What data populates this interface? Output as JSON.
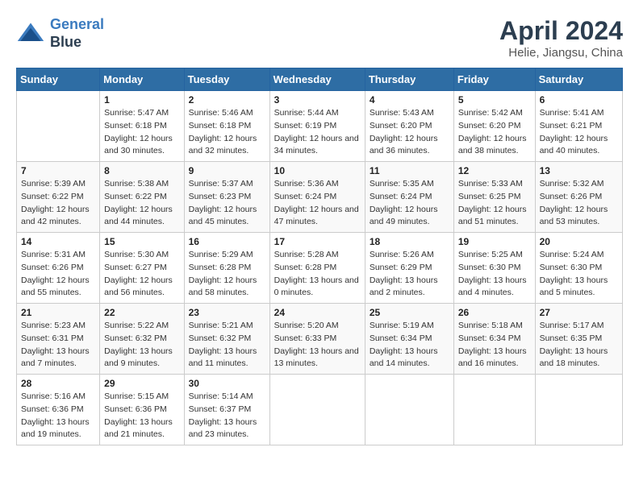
{
  "header": {
    "logo_line1": "General",
    "logo_line2": "Blue",
    "month_year": "April 2024",
    "location": "Helie, Jiangsu, China"
  },
  "days_of_week": [
    "Sunday",
    "Monday",
    "Tuesday",
    "Wednesday",
    "Thursday",
    "Friday",
    "Saturday"
  ],
  "weeks": [
    [
      {
        "day": "",
        "sunrise": "",
        "sunset": "",
        "daylight": ""
      },
      {
        "day": "1",
        "sunrise": "Sunrise: 5:47 AM",
        "sunset": "Sunset: 6:18 PM",
        "daylight": "Daylight: 12 hours and 30 minutes."
      },
      {
        "day": "2",
        "sunrise": "Sunrise: 5:46 AM",
        "sunset": "Sunset: 6:18 PM",
        "daylight": "Daylight: 12 hours and 32 minutes."
      },
      {
        "day": "3",
        "sunrise": "Sunrise: 5:44 AM",
        "sunset": "Sunset: 6:19 PM",
        "daylight": "Daylight: 12 hours and 34 minutes."
      },
      {
        "day": "4",
        "sunrise": "Sunrise: 5:43 AM",
        "sunset": "Sunset: 6:20 PM",
        "daylight": "Daylight: 12 hours and 36 minutes."
      },
      {
        "day": "5",
        "sunrise": "Sunrise: 5:42 AM",
        "sunset": "Sunset: 6:20 PM",
        "daylight": "Daylight: 12 hours and 38 minutes."
      },
      {
        "day": "6",
        "sunrise": "Sunrise: 5:41 AM",
        "sunset": "Sunset: 6:21 PM",
        "daylight": "Daylight: 12 hours and 40 minutes."
      }
    ],
    [
      {
        "day": "7",
        "sunrise": "Sunrise: 5:39 AM",
        "sunset": "Sunset: 6:22 PM",
        "daylight": "Daylight: 12 hours and 42 minutes."
      },
      {
        "day": "8",
        "sunrise": "Sunrise: 5:38 AM",
        "sunset": "Sunset: 6:22 PM",
        "daylight": "Daylight: 12 hours and 44 minutes."
      },
      {
        "day": "9",
        "sunrise": "Sunrise: 5:37 AM",
        "sunset": "Sunset: 6:23 PM",
        "daylight": "Daylight: 12 hours and 45 minutes."
      },
      {
        "day": "10",
        "sunrise": "Sunrise: 5:36 AM",
        "sunset": "Sunset: 6:24 PM",
        "daylight": "Daylight: 12 hours and 47 minutes."
      },
      {
        "day": "11",
        "sunrise": "Sunrise: 5:35 AM",
        "sunset": "Sunset: 6:24 PM",
        "daylight": "Daylight: 12 hours and 49 minutes."
      },
      {
        "day": "12",
        "sunrise": "Sunrise: 5:33 AM",
        "sunset": "Sunset: 6:25 PM",
        "daylight": "Daylight: 12 hours and 51 minutes."
      },
      {
        "day": "13",
        "sunrise": "Sunrise: 5:32 AM",
        "sunset": "Sunset: 6:26 PM",
        "daylight": "Daylight: 12 hours and 53 minutes."
      }
    ],
    [
      {
        "day": "14",
        "sunrise": "Sunrise: 5:31 AM",
        "sunset": "Sunset: 6:26 PM",
        "daylight": "Daylight: 12 hours and 55 minutes."
      },
      {
        "day": "15",
        "sunrise": "Sunrise: 5:30 AM",
        "sunset": "Sunset: 6:27 PM",
        "daylight": "Daylight: 12 hours and 56 minutes."
      },
      {
        "day": "16",
        "sunrise": "Sunrise: 5:29 AM",
        "sunset": "Sunset: 6:28 PM",
        "daylight": "Daylight: 12 hours and 58 minutes."
      },
      {
        "day": "17",
        "sunrise": "Sunrise: 5:28 AM",
        "sunset": "Sunset: 6:28 PM",
        "daylight": "Daylight: 13 hours and 0 minutes."
      },
      {
        "day": "18",
        "sunrise": "Sunrise: 5:26 AM",
        "sunset": "Sunset: 6:29 PM",
        "daylight": "Daylight: 13 hours and 2 minutes."
      },
      {
        "day": "19",
        "sunrise": "Sunrise: 5:25 AM",
        "sunset": "Sunset: 6:30 PM",
        "daylight": "Daylight: 13 hours and 4 minutes."
      },
      {
        "day": "20",
        "sunrise": "Sunrise: 5:24 AM",
        "sunset": "Sunset: 6:30 PM",
        "daylight": "Daylight: 13 hours and 5 minutes."
      }
    ],
    [
      {
        "day": "21",
        "sunrise": "Sunrise: 5:23 AM",
        "sunset": "Sunset: 6:31 PM",
        "daylight": "Daylight: 13 hours and 7 minutes."
      },
      {
        "day": "22",
        "sunrise": "Sunrise: 5:22 AM",
        "sunset": "Sunset: 6:32 PM",
        "daylight": "Daylight: 13 hours and 9 minutes."
      },
      {
        "day": "23",
        "sunrise": "Sunrise: 5:21 AM",
        "sunset": "Sunset: 6:32 PM",
        "daylight": "Daylight: 13 hours and 11 minutes."
      },
      {
        "day": "24",
        "sunrise": "Sunrise: 5:20 AM",
        "sunset": "Sunset: 6:33 PM",
        "daylight": "Daylight: 13 hours and 13 minutes."
      },
      {
        "day": "25",
        "sunrise": "Sunrise: 5:19 AM",
        "sunset": "Sunset: 6:34 PM",
        "daylight": "Daylight: 13 hours and 14 minutes."
      },
      {
        "day": "26",
        "sunrise": "Sunrise: 5:18 AM",
        "sunset": "Sunset: 6:34 PM",
        "daylight": "Daylight: 13 hours and 16 minutes."
      },
      {
        "day": "27",
        "sunrise": "Sunrise: 5:17 AM",
        "sunset": "Sunset: 6:35 PM",
        "daylight": "Daylight: 13 hours and 18 minutes."
      }
    ],
    [
      {
        "day": "28",
        "sunrise": "Sunrise: 5:16 AM",
        "sunset": "Sunset: 6:36 PM",
        "daylight": "Daylight: 13 hours and 19 minutes."
      },
      {
        "day": "29",
        "sunrise": "Sunrise: 5:15 AM",
        "sunset": "Sunset: 6:36 PM",
        "daylight": "Daylight: 13 hours and 21 minutes."
      },
      {
        "day": "30",
        "sunrise": "Sunrise: 5:14 AM",
        "sunset": "Sunset: 6:37 PM",
        "daylight": "Daylight: 13 hours and 23 minutes."
      },
      {
        "day": "",
        "sunrise": "",
        "sunset": "",
        "daylight": ""
      },
      {
        "day": "",
        "sunrise": "",
        "sunset": "",
        "daylight": ""
      },
      {
        "day": "",
        "sunrise": "",
        "sunset": "",
        "daylight": ""
      },
      {
        "day": "",
        "sunrise": "",
        "sunset": "",
        "daylight": ""
      }
    ]
  ]
}
